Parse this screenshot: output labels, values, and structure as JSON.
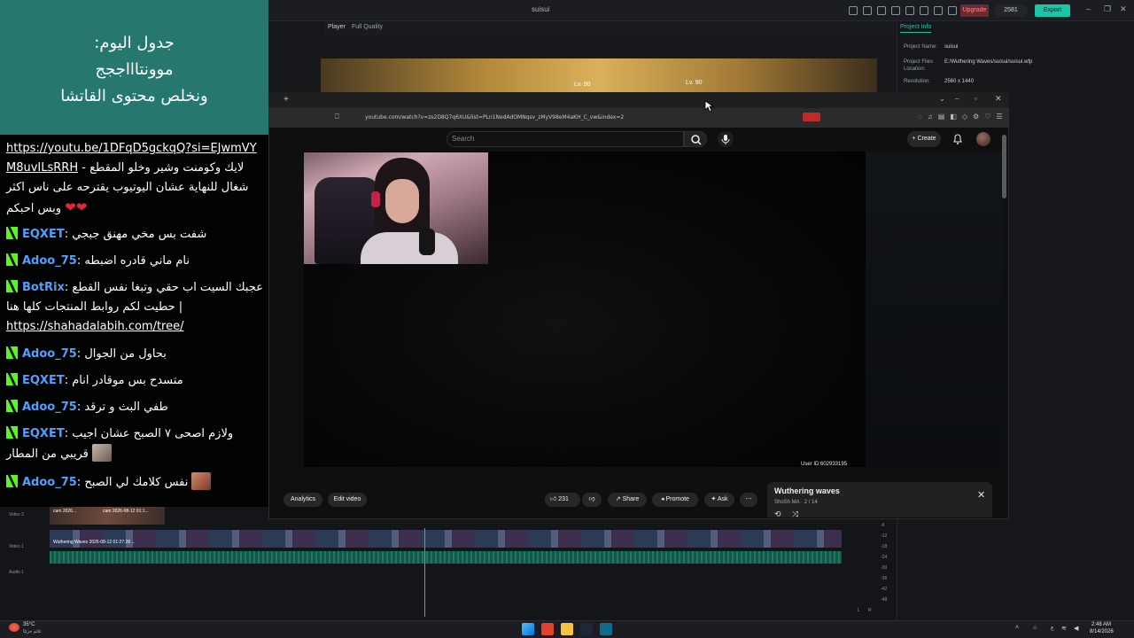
{
  "editor": {
    "title": "suisui",
    "upgrade_label": "Upgrade",
    "credits": "2581",
    "export_label": "Export",
    "player_label": "Player",
    "quality": "Full Quality",
    "preview_levels": [
      "Lv. 90",
      "Lv. 90"
    ],
    "project_info": {
      "tab": "Project Info",
      "name_key": "Project Name:",
      "name_val": "suisui",
      "files_key": "Project Files Location:",
      "files_val": "E:/Wuthering Waves/suisui/suisui.wfp",
      "res_key": "Resolution:",
      "res_val": "2560 x 1440"
    },
    "timeline": {
      "tracks": [
        "Video 2",
        "Video 1",
        "Audio 1"
      ],
      "clip_labels": [
        "cam 2026...",
        "cam 2026-08-12 01:1...",
        "Wuthering Waves 2026-08-12 01:27:28 ..."
      ],
      "meter_db": [
        "-6",
        "-12",
        "-18",
        "-24",
        "-30",
        "-36",
        "-42",
        "-48",
        "-54"
      ],
      "meter_lr": [
        "L",
        "R"
      ]
    }
  },
  "stream_overlay": {
    "schedule_lines": [
      "جدول اليوم:",
      "موونتاااججج",
      "ونخلص محتوى القاتشا"
    ],
    "chat": [
      {
        "user": "",
        "text": "",
        "link": "https://youtu.be/1DFqD5gckqQ?si=EJwmVYM8uvILsRRH",
        "after": " - لايك وكومنت وشير وخلو المقطع شغال للنهاية عشان اليوتيوب يقترحه على ناس اكثر وبس احبكم"
      },
      {
        "user": "EQXET",
        "text": "شفت بس مخي مهنق جبجي"
      },
      {
        "user": "Adoo_75",
        "text": "نام ماني قادره اضبطه"
      },
      {
        "user": "BotRix",
        "text": "عجبك السيت اب حقي وتبغا نفس القطع | حطيت لكم روابط المنتجات كلها هنا",
        "link": "https://shahadalabih.com/tree/"
      },
      {
        "user": "Adoo_75",
        "text": "بحاول من الجوال"
      },
      {
        "user": "EQXET",
        "text": "متسدح بس موقادر انام"
      },
      {
        "user": "Adoo_75",
        "text": "طفي البث و ترقد"
      },
      {
        "user": "EQXET",
        "text": "ولازم اصحى ٧ الصبح عشان اجيب قريبي من المطار"
      },
      {
        "user": "Adoo_75",
        "text": "نفس كلامك لي الصبح"
      }
    ]
  },
  "browser": {
    "url": "youtube.com/watch?v=zs2D8Q7q6XU&list=PLn1NedAdOMNqsv_zMyV98eM4aKH_C_vw&index=2",
    "search_placeholder": "Search",
    "create_label": "Create",
    "user_id": "User ID:602933195",
    "actions": {
      "analytics": "Analytics",
      "edit_video": "Edit video",
      "likes": "231",
      "share": "Share",
      "promote": "Promote",
      "ask": "Ask"
    },
    "playlist": {
      "title": "Wuthering waves",
      "channel": "ShoSh MA",
      "position": "2 / 14"
    }
  },
  "taskbar": {
    "temp": "35°C",
    "weather": "غائم جزئيًا",
    "time": "2:48 AM",
    "date": "8/14/2026",
    "lang": "ع"
  }
}
